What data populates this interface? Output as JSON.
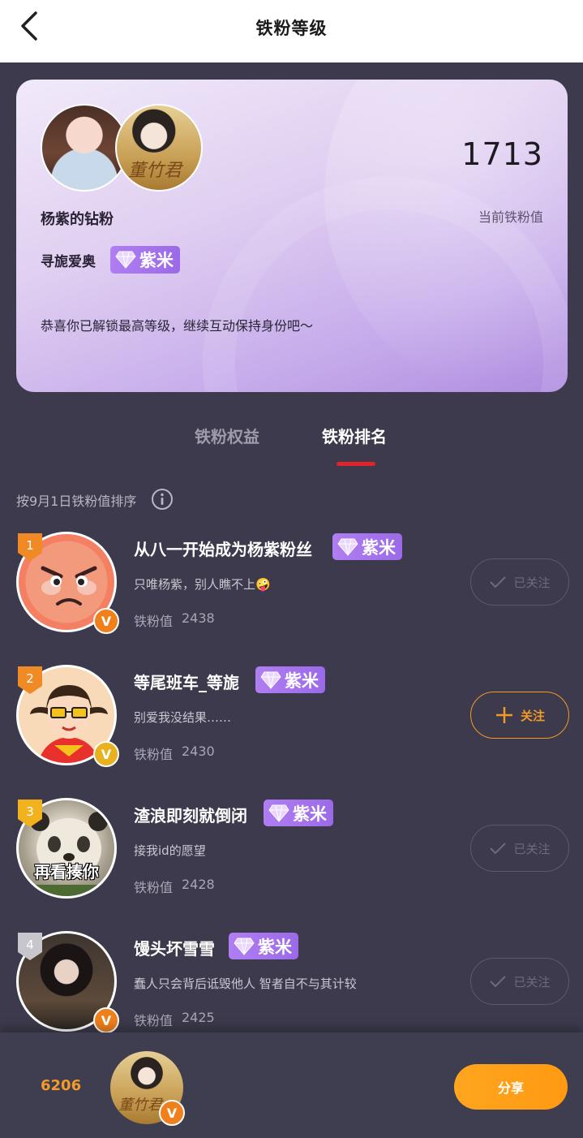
{
  "header": {
    "title": "铁粉等级",
    "back_icon": "chevron-left-icon"
  },
  "card": {
    "fan_title": "杨紫的钻粉",
    "group_name": "寻旎爱奥",
    "badge_label": "紫米",
    "badge_icon": "diamond-icon",
    "score": "1713",
    "score_label": "当前铁粉值",
    "congrats": "恭喜你已解锁最高等级，继续互动保持身份吧～",
    "poster_text": "董竹君"
  },
  "tabs": [
    {
      "label": "铁粉权益",
      "active": false
    },
    {
      "label": "铁粉排名",
      "active": true
    }
  ],
  "sort_note": "按9月1日铁粉值排序",
  "ranking": [
    {
      "rank": "1",
      "name": "从八一开始成为杨紫粉丝",
      "badge": "紫米",
      "signature": "只唯杨紫，别人瞧不上🤪",
      "score_label": "铁粉值",
      "score": "2438",
      "follow_label": "已关注",
      "followed": true,
      "flag_color": "#f08a24"
    },
    {
      "rank": "2",
      "name": "等尾班车_等旎",
      "badge": "紫米",
      "signature": "别爱我没结果……",
      "score_label": "铁粉值",
      "score": "2430",
      "follow_label": "关注",
      "followed": false,
      "flag_color": "#f08a24"
    },
    {
      "rank": "3",
      "name": "渣浪即刻就倒闭",
      "badge": "紫米",
      "signature": "接我id的愿望",
      "score_label": "铁粉值",
      "score": "2428",
      "follow_label": "已关注",
      "followed": true,
      "flag_color": "#f2b21e"
    },
    {
      "rank": "4",
      "name": "馒头坏雪雪",
      "badge": "紫米",
      "signature": "蠢人只会背后诋毁他人 智者自不与其计较",
      "score_label": "铁粉值",
      "score": "2425",
      "follow_label": "已关注",
      "followed": true,
      "flag_color": "#c6c6cc"
    }
  ],
  "panda_caption": "再看揍你",
  "bottom": {
    "my_rank": "6206",
    "share_label": "分享",
    "poster_text": "董竹君"
  },
  "colors": {
    "accent": "#f39a26",
    "tab_indicator": "#e0242a",
    "badge_purple": "#a774ee",
    "background": "#3c3a4c"
  }
}
